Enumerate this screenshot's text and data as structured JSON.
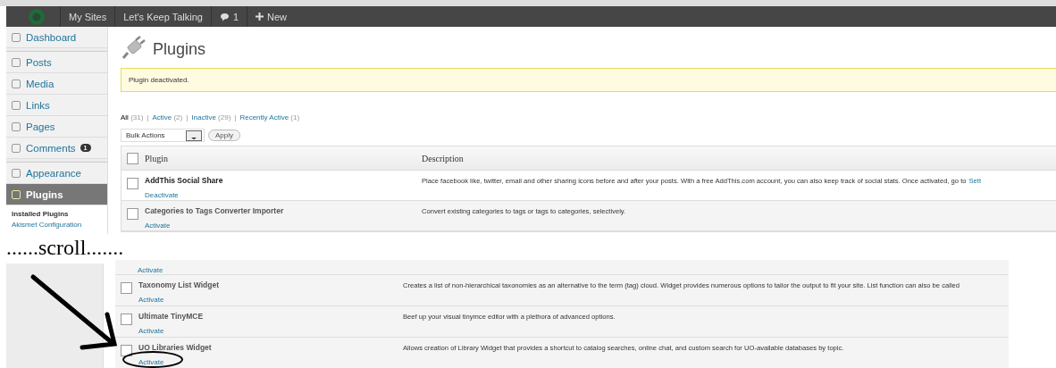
{
  "admin_bar": {
    "sites": "My Sites",
    "site_name": "Let's Keep Talking",
    "comments": "1",
    "new": "New"
  },
  "sidebar": {
    "items": [
      {
        "label": "Dashboard",
        "selected": false
      },
      {
        "label": "Posts",
        "selected": false
      },
      {
        "label": "Media",
        "selected": false
      },
      {
        "label": "Links",
        "selected": false
      },
      {
        "label": "Pages",
        "selected": false
      },
      {
        "label": "Comments",
        "badge": "1",
        "selected": false
      },
      {
        "label": "Appearance",
        "selected": false
      },
      {
        "label": "Plugins",
        "selected": true
      }
    ],
    "submenu": [
      {
        "label": "Installed Plugins",
        "selected": true
      },
      {
        "label": "Akismet Configuration",
        "selected": false
      }
    ]
  },
  "page_title": "Plugins",
  "notice": "Plugin deactivated.",
  "filters": [
    {
      "label": "All",
      "count": "(31)",
      "selected": true
    },
    {
      "separator": "|",
      "label": "Active",
      "count": "(2)",
      "selected": false
    },
    {
      "separator": "|",
      "label": "Inactive",
      "count": "(29)",
      "selected": false
    },
    {
      "separator": "|",
      "label": "Recently Active",
      "count": "(1)",
      "selected": false
    }
  ],
  "bulk_actions": {
    "value": "Bulk Actions",
    "apply": "Apply"
  },
  "table": {
    "columns": [
      "Plugin",
      "Description"
    ],
    "select_all_checked": false,
    "rows": [
      {
        "name": "AddThis Social Share",
        "action": "Deactivate",
        "active": true,
        "checked": false,
        "description": "Place facebook like, twitter, email and other sharing icons before and after your posts. With a free AddThis.com account, you can also keep track of social stats. Once activated, go to",
        "link": "Sett"
      },
      {
        "name": "Categories to Tags Converter Importer",
        "action": "Activate",
        "active": false,
        "checked": false,
        "description": "Convert existing categories to tags or tags to categories, selectively."
      }
    ]
  },
  "annotation": "......scroll.......",
  "lower_table": {
    "rows": [
      {
        "action": "Activate",
        "circled": false
      },
      {
        "name": "Taxonomy List Widget",
        "action": "Activate",
        "active": false,
        "checked": false,
        "circled": false,
        "description": "Creates a list of non-hierarchical taxonomies as an alternative to the term (tag) cloud. Widget provides numerous options to tailor the output to fit your site. List function can also be called"
      },
      {
        "name": "Ultimate TinyMCE",
        "action": "Activate",
        "active": false,
        "checked": false,
        "circled": false,
        "description": "Beef up your visual tinymce editor with a plethora of advanced options."
      },
      {
        "name": "UO Libraries Widget",
        "action": "Activate",
        "active": false,
        "checked": false,
        "circled": true,
        "description": "Allows creation of Library Widget that provides a shortcut to catalog searches, online chat, and custom search for UO-available databases by topic."
      }
    ]
  }
}
